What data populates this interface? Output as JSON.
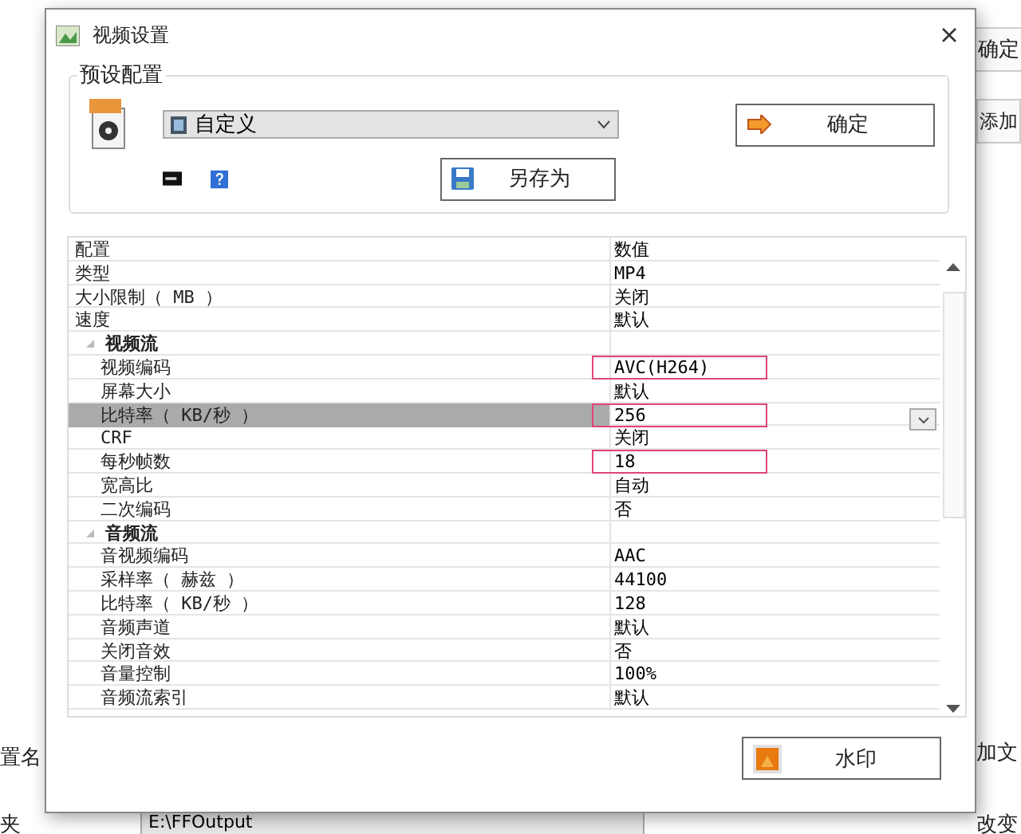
{
  "background_app": {
    "top_right_button": "确定",
    "add_button": "添加",
    "add_button_2": "加文",
    "preset_name_label": "置名",
    "folder_label": "夹",
    "output_folder": "E:\\FFOutput",
    "change_button": "改变"
  },
  "window": {
    "title": "视频设置"
  },
  "preset_group": {
    "title": "预设配置",
    "preset_select": "自定义",
    "ok_button": "确定",
    "save_as_button": "另存为"
  },
  "property_grid": {
    "columns": [
      "配置",
      "数值"
    ],
    "rows": [
      {
        "kind": "item",
        "name": "类型",
        "value": "MP4",
        "highlighted": false,
        "selected": false
      },
      {
        "kind": "item",
        "name": "大小限制（ MB ）",
        "value": "关闭",
        "highlighted": false,
        "selected": false
      },
      {
        "kind": "item",
        "name": "速度",
        "value": "默认",
        "highlighted": false,
        "selected": false
      },
      {
        "kind": "category",
        "name": "视频流",
        "expanded": true,
        "children": [
          {
            "kind": "item",
            "name": "视频编码",
            "value": "AVC(H264)",
            "highlighted": true,
            "selected": false
          },
          {
            "kind": "item",
            "name": "屏幕大小",
            "value": "默认",
            "highlighted": false,
            "selected": false
          },
          {
            "kind": "item",
            "name": "比特率（ KB/秒 ）",
            "value": "256",
            "highlighted": true,
            "selected": true
          },
          {
            "kind": "item",
            "name": "CRF",
            "value": "关闭",
            "highlighted": false,
            "selected": false
          },
          {
            "kind": "item",
            "name": "每秒帧数",
            "value": "18",
            "highlighted": true,
            "selected": false
          },
          {
            "kind": "item",
            "name": "宽高比",
            "value": "自动",
            "highlighted": false,
            "selected": false
          },
          {
            "kind": "item",
            "name": "二次编码",
            "value": "否",
            "highlighted": false,
            "selected": false
          }
        ]
      },
      {
        "kind": "category",
        "name": "音频流",
        "expanded": true,
        "children": [
          {
            "kind": "item",
            "name": "音视频编码",
            "value": "AAC",
            "highlighted": false,
            "selected": false
          },
          {
            "kind": "item",
            "name": "采样率（ 赫兹 ）",
            "value": "44100",
            "highlighted": false,
            "selected": false
          },
          {
            "kind": "item",
            "name": "比特率（ KB/秒 ）",
            "value": "128",
            "highlighted": false,
            "selected": false
          },
          {
            "kind": "item",
            "name": "音频声道",
            "value": "默认",
            "highlighted": false,
            "selected": false
          },
          {
            "kind": "item",
            "name": "关闭音效",
            "value": "否",
            "highlighted": false,
            "selected": false
          },
          {
            "kind": "item",
            "name": "音量控制",
            "value": "100%",
            "highlighted": false,
            "selected": false
          },
          {
            "kind": "item",
            "name": "音频流索引",
            "value": "默认",
            "highlighted": false,
            "selected": false
          }
        ]
      }
    ]
  },
  "watermark_button": "水印"
}
